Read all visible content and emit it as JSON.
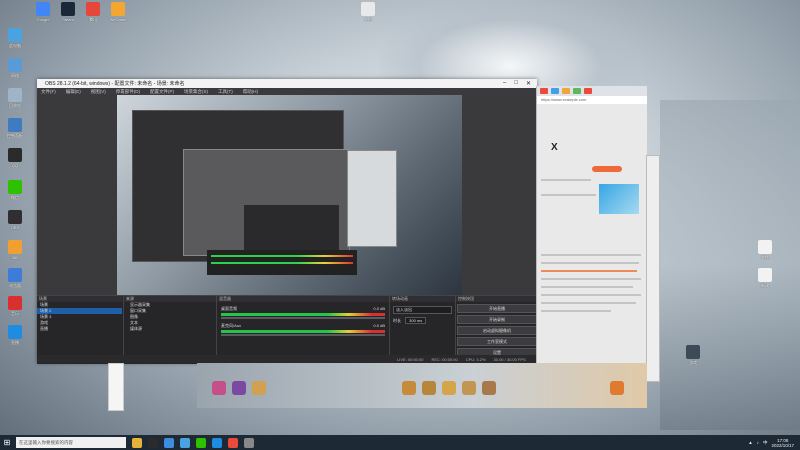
{
  "desktop": {
    "icons_left": [
      {
        "label": "此电脑",
        "color": "#4aa3e0"
      },
      {
        "label": "网络",
        "color": "#5b9bd5"
      },
      {
        "label": "回收站",
        "color": "#9fb4c6"
      },
      {
        "label": "控制面板",
        "color": "#3f7bbf"
      },
      {
        "label": "QQ",
        "color": "#2b2b2b"
      },
      {
        "label": "微信",
        "color": "#2dc100"
      },
      {
        "label": "OBS",
        "color": "#302e31"
      },
      {
        "label": "360",
        "color": "#f0a030"
      },
      {
        "label": "浏览器",
        "color": "#3d7dd8"
      },
      {
        "label": "音乐",
        "color": "#d8302f"
      },
      {
        "label": "直播",
        "color": "#1e8ce0"
      }
    ],
    "icons_top": [
      {
        "label": "Google",
        "color": "#4285f4"
      },
      {
        "label": "Steam",
        "color": "#1b2838"
      },
      {
        "label": "腾讯",
        "color": "#e5483b"
      },
      {
        "label": "WeGame",
        "color": "#f3a731"
      },
      {
        "label": "文档",
        "color": "#e9e9e9"
      }
    ],
    "icons_right": [
      {
        "label": "文件",
        "color": "#f2f2f2"
      },
      {
        "label": "新建",
        "color": "#f2f2f2"
      },
      {
        "label": "游戏",
        "color": "#3d4a57"
      }
    ]
  },
  "obs": {
    "title": "OBS 28.1.2 (64-bit, windows) - 配置文件: 未命名 - 场景: 未命名",
    "menu": [
      "文件(F)",
      "编辑(E)",
      "视图(V)",
      "停靠部件(D)",
      "配置文件(P)",
      "场景集合(S)",
      "工具(T)",
      "帮助(H)"
    ],
    "docks": {
      "scenes": {
        "title": "场景",
        "items": [
          "场景",
          "场景 2",
          "场景 3",
          "游戏",
          "直播"
        ]
      },
      "sources": {
        "title": "来源",
        "items": [
          "显示器采集",
          "窗口采集",
          "图像",
          "文本",
          "媒体源"
        ]
      },
      "mixer": {
        "title": "混音器",
        "rows": [
          {
            "name": "桌面音频",
            "value": "0.0 dB"
          },
          {
            "name": "麦克风/Aux",
            "value": "0.0 dB"
          }
        ]
      },
      "transitions": {
        "title": "转场动画",
        "type": "淡入淡出",
        "duration_label": "时长",
        "duration": "300 ms"
      },
      "controls": {
        "title": "控制按钮",
        "buttons": [
          "开始直播",
          "开始录制",
          "启动虚拟摄像机",
          "工作室模式",
          "设置",
          "退出"
        ]
      }
    },
    "status": [
      "LIVE: 00:00:00",
      "REC: 00:00:00",
      "CPU: 3.2%",
      "30.00 / 30.00 FPS"
    ]
  },
  "browser": {
    "address": "https://www.example.com",
    "close_glyph": "X"
  },
  "taskbar": {
    "search_placeholder": "在这里输入你要搜索的内容",
    "time": "17:08",
    "date": "2022/10/17",
    "lang": "中"
  }
}
